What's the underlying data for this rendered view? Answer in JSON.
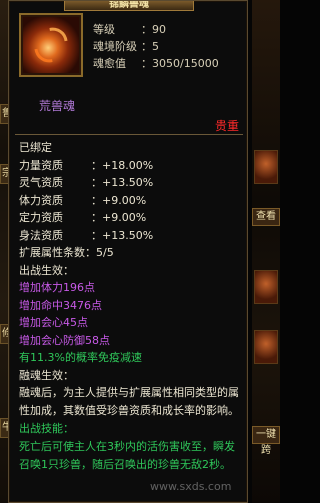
{
  "title": "锦鳞兽魂",
  "stats": [
    {
      "k": "等级",
      "v": "90"
    },
    {
      "k": "魂境阶级",
      "v": "5"
    },
    {
      "k": "魂愈值",
      "v": "3050/15000"
    }
  ],
  "item_name": "荒兽魂",
  "quality": "贵重",
  "bound": "已绑定",
  "attrs": [
    {
      "k": "力量资质",
      "v": "+18.00%"
    },
    {
      "k": "灵气资质",
      "v": "+13.50%"
    },
    {
      "k": "体力资质",
      "v": "+9.00%"
    },
    {
      "k": "定力资质",
      "v": "+9.00%"
    },
    {
      "k": "身法资质",
      "v": "+13.50%"
    }
  ],
  "ext_count": {
    "k": "扩展属性条数",
    "v": "5/5"
  },
  "effect_title": "出战生效：",
  "effects": [
    {
      "text": "增加体力196点",
      "color": "purple"
    },
    {
      "text": "增加命中3476点",
      "color": "purple"
    },
    {
      "text": "增加会心45点",
      "color": "purple"
    },
    {
      "text": "增加会心防御58点",
      "color": "purple"
    },
    {
      "text": "有11.3%的概率免疫减速",
      "color": "green"
    }
  ],
  "fuse_title": "融魂生效：",
  "fuse_desc": "融魂后，为主人提供与扩展属性相同类型的属性加成，其数值受珍兽资质和成长率的影响。",
  "skill_title": "出战技能：",
  "skill_desc": "死亡后可使主人在3秒内的活伤害收至，瞬发召唤1只珍兽，随后召唤出的珍兽无敌2秒。",
  "left_labels": [
    "鲁",
    "宗",
    "修",
    "牛"
  ],
  "right_labels": [
    "查看",
    "一键跨"
  ],
  "watermark": "www.sxds.com"
}
